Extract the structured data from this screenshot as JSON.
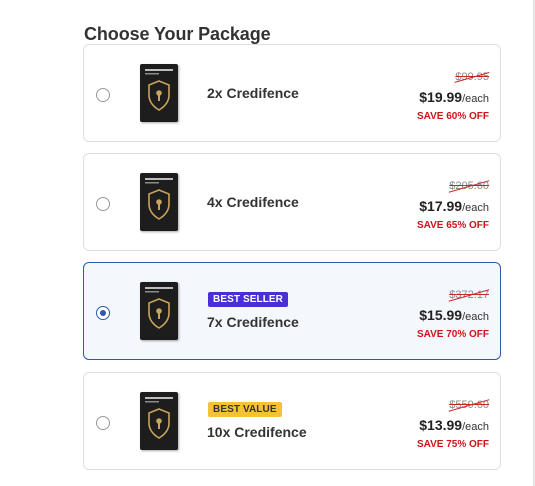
{
  "page": {
    "title": "Choose Your Package"
  },
  "packages": [
    {
      "name": "2x Credifence",
      "badge": "",
      "old_price": "$99.95",
      "price": "$19.99",
      "per_unit": "/each",
      "save": "SAVE 60% OFF",
      "selected": false
    },
    {
      "name": "4x Credifence",
      "badge": "",
      "old_price": "$205.60",
      "price": "$17.99",
      "per_unit": "/each",
      "save": "SAVE 65% OFF",
      "selected": false
    },
    {
      "name": "7x Credifence",
      "badge": "BEST SELLER",
      "old_price": "$372.17",
      "price": "$15.99",
      "per_unit": "/each",
      "save": "SAVE 70% OFF",
      "selected": true
    },
    {
      "name": "10x Credifence",
      "badge": "BEST VALUE",
      "old_price": "$559.60",
      "price": "$13.99",
      "per_unit": "/each",
      "save": "SAVE 75% OFF",
      "selected": false
    }
  ],
  "colors": {
    "selected_border": "#2b5aa8",
    "badge_best_seller": "#4a2fd6",
    "badge_best_value": "#f5c233",
    "save_text": "#d0121b"
  },
  "icons": {
    "product": "shield-keyhole-icon"
  }
}
